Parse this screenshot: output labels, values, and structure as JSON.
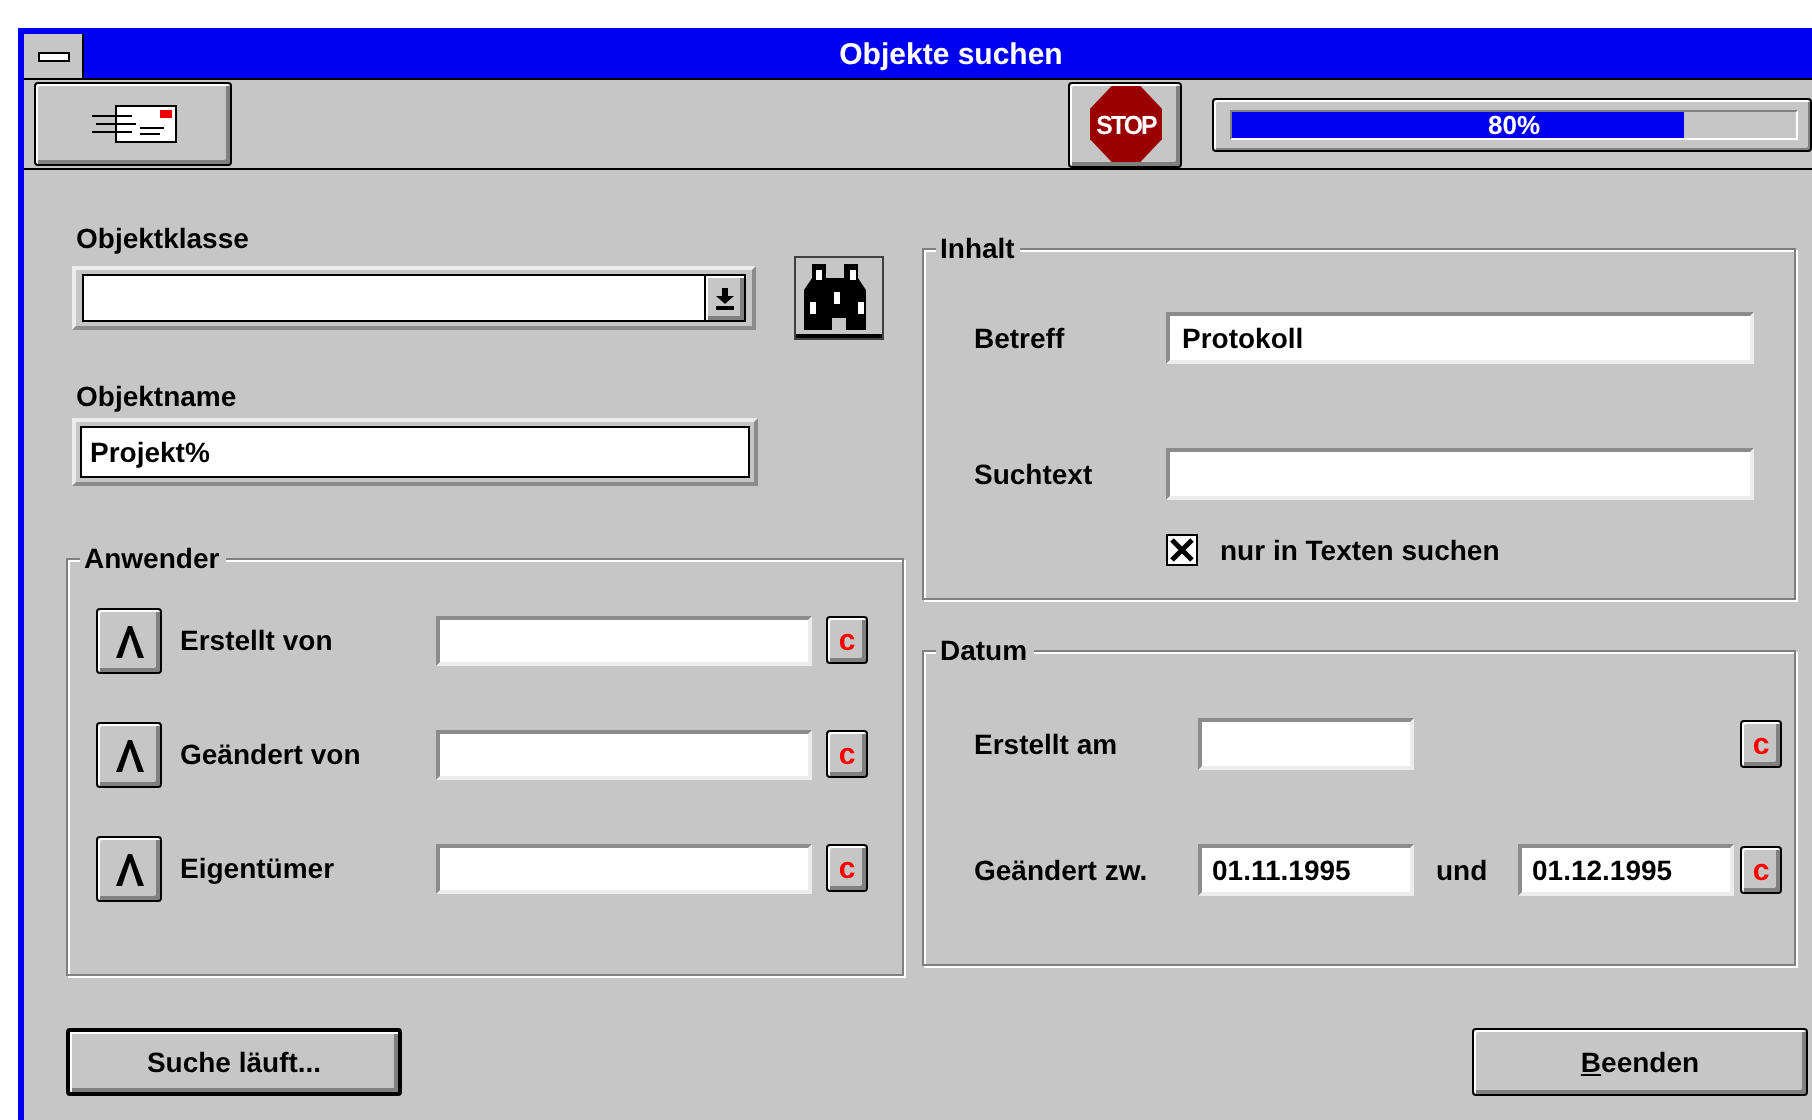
{
  "window": {
    "title": "Objekte suchen"
  },
  "toolbar": {
    "stop_label": "STOP",
    "progress": {
      "level": 0.8,
      "reading": "80%"
    }
  },
  "object_class": {
    "label": "Objektklasse"
  },
  "object_name": {
    "label": "Objektname",
    "value": "Projekt%"
  },
  "users": {
    "title": "Anwender",
    "rows": [
      {
        "label": "Erstellt von",
        "clear": "c"
      },
      {
        "label": "Geändert von",
        "clear": "c"
      },
      {
        "label": "Eigentümer",
        "clear": "c"
      }
    ]
  },
  "content": {
    "title": "Inhalt",
    "subject": {
      "label": "Betreff",
      "value": "Protokoll"
    },
    "search_text": {
      "label": "Suchtext"
    },
    "only_texts": {
      "label": "nur in Texten suchen",
      "checked": true
    }
  },
  "date": {
    "title": "Datum",
    "created": {
      "label": "Erstellt am",
      "clear": "c"
    },
    "changed": {
      "label": "Geändert zw.",
      "from": "01.11.1995",
      "joiner": "und",
      "to": "01.12.1995",
      "clear": "c"
    }
  },
  "buttons": [
    {
      "label": "Suche läuft...",
      "default": true,
      "mnemonic": false
    },
    {
      "label": "Beenden",
      "default": false,
      "mnemonic": true
    }
  ]
}
